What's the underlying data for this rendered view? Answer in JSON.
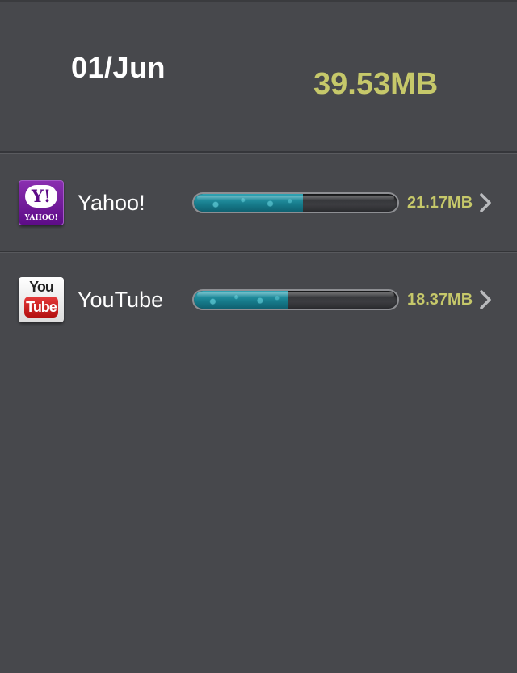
{
  "header": {
    "date": "01/Jun",
    "total_usage": "39.53MB"
  },
  "apps": [
    {
      "name": "Yahoo!",
      "icon": "yahoo-app-icon",
      "icon_text_main": "Y!",
      "icon_text_sub": "YAHOO!",
      "usage": "21.17MB",
      "usage_fraction": 0.536
    },
    {
      "name": "YouTube",
      "icon": "youtube-app-icon",
      "icon_text_top": "You",
      "icon_text_bottom": "Tube",
      "usage": "18.37MB",
      "usage_fraction": 0.465
    }
  ],
  "colors": {
    "background": "#47484c",
    "accent_value": "#c6c86a",
    "bar_fill": "#1e8f9f"
  }
}
